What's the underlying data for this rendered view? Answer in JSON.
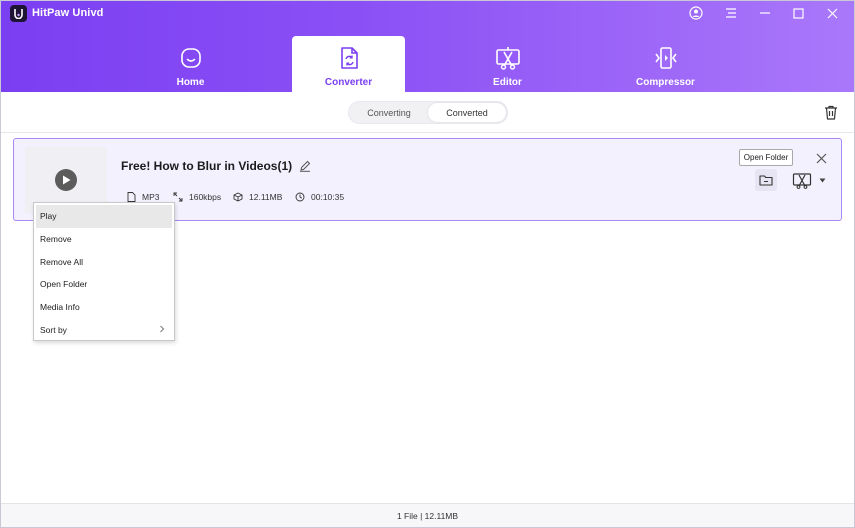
{
  "app": {
    "title": "HitPaw Univd"
  },
  "nav": {
    "tabs": [
      {
        "label": "Home",
        "icon": "home-icon"
      },
      {
        "label": "Converter",
        "icon": "converter-icon",
        "active": true
      },
      {
        "label": "Editor",
        "icon": "editor-icon"
      },
      {
        "label": "Compressor",
        "icon": "compressor-icon"
      }
    ]
  },
  "subtabs": [
    {
      "label": "Converting"
    },
    {
      "label": "Converted",
      "active": true
    }
  ],
  "file": {
    "title": "Free! How to Blur in Videos(1)",
    "format": "MP3",
    "bitrate": "160kbps",
    "size": "12.11MB",
    "duration": "00:10:35"
  },
  "tooltip": {
    "text": "Open Folder"
  },
  "context_menu": {
    "items": [
      {
        "label": "Play"
      },
      {
        "label": "Remove"
      },
      {
        "label": "Remove All"
      },
      {
        "label": "Open Folder"
      },
      {
        "label": "Media Info"
      },
      {
        "label": "Sort by",
        "submenu": true
      }
    ]
  },
  "footer": {
    "summary": "1 File | 12.11MB"
  },
  "colors": {
    "accent": "#7b3ff2",
    "header_end": "#a978fa",
    "card_bg": "#f4f1ff",
    "card_border": "#a889f5"
  }
}
